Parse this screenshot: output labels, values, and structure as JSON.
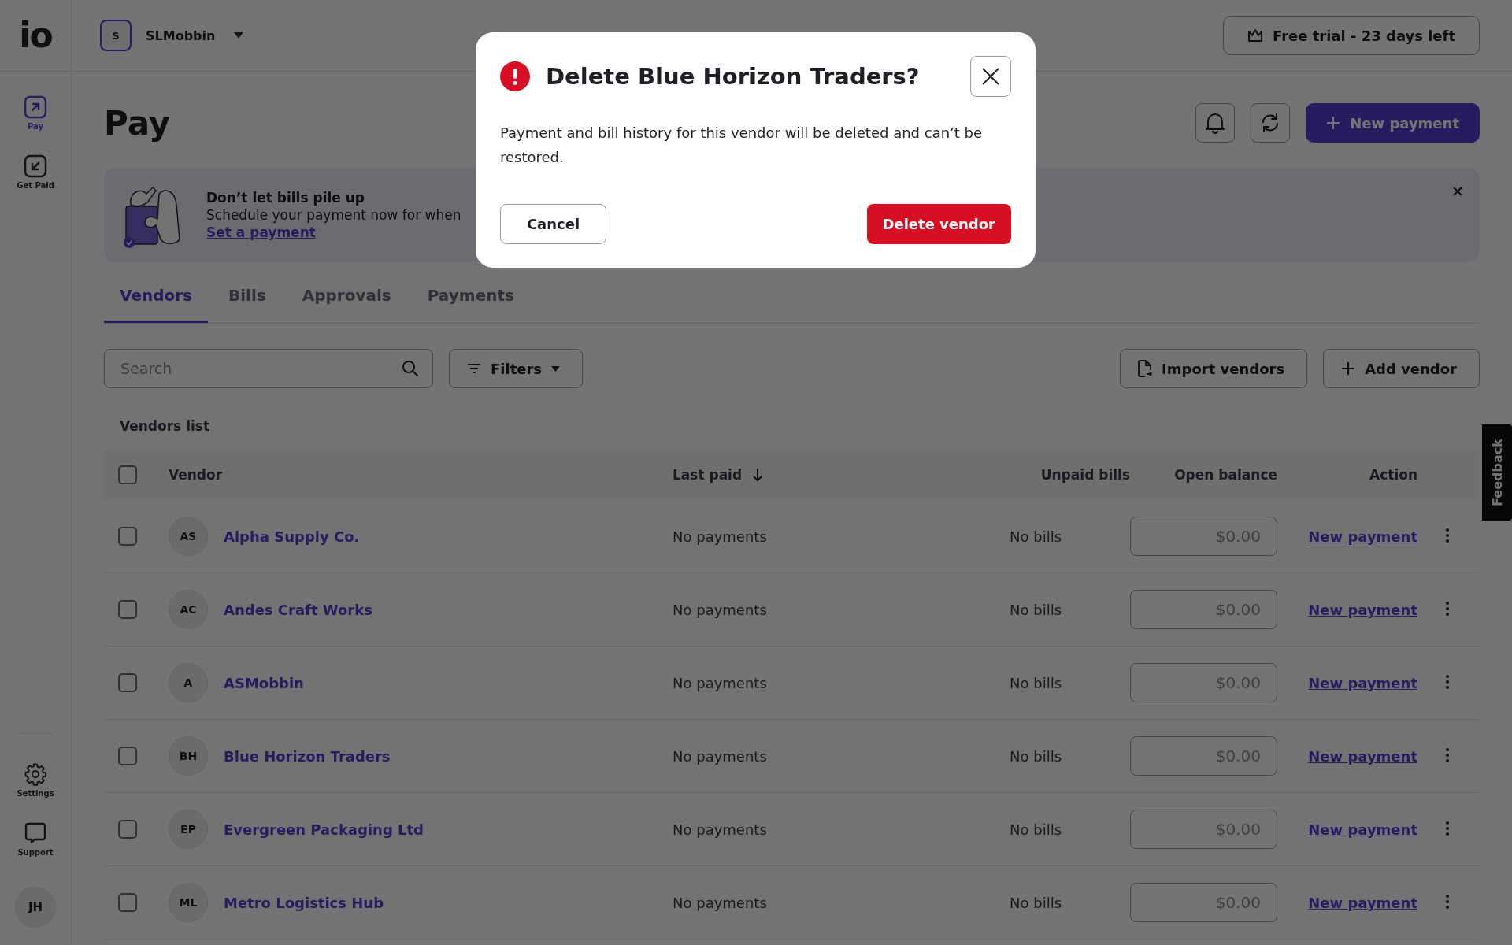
{
  "logo": "io",
  "sidebar": {
    "items": [
      {
        "label": "Pay",
        "kind": "pay",
        "selected": true
      },
      {
        "label": "Get Paid",
        "kind": "get-paid",
        "selected": false
      }
    ],
    "bottom_items": [
      {
        "label": "Settings",
        "kind": "settings"
      },
      {
        "label": "Support",
        "kind": "support"
      }
    ],
    "user_initials": "JH"
  },
  "header": {
    "workspace_initial": "S",
    "workspace_name": "SLMobbin",
    "trial_badge": "Free trial - 23 days left"
  },
  "page": {
    "title": "Pay",
    "new_payment_button": "New payment"
  },
  "banner": {
    "title": "Don’t let bills pile up",
    "text": "Schedule your payment now for when",
    "link": "Set a payment"
  },
  "tabs": [
    {
      "label": "Vendors",
      "selected": true
    },
    {
      "label": "Bills",
      "selected": false
    },
    {
      "label": "Approvals",
      "selected": false
    },
    {
      "label": "Payments",
      "selected": false
    }
  ],
  "search": {
    "placeholder": "Search"
  },
  "filters_button": "Filters",
  "import_button": "Import vendors",
  "add_button": "Add vendor",
  "list_title": "Vendors list",
  "table": {
    "select_all_checked": false,
    "columns": [
      {
        "label": "Vendor",
        "sorted": false
      },
      {
        "label": "Last paid",
        "sorted": true
      },
      {
        "label": "Unpaid bills",
        "sorted": false
      },
      {
        "label": "Open balance",
        "sorted": false
      },
      {
        "label": "Action",
        "sorted": false
      }
    ],
    "rows": [
      {
        "checked": false,
        "initials": "AS",
        "name": "Alpha Supply Co.",
        "last_paid": "No payments",
        "unpaid_bills": "No bills",
        "open_balance": "$0.00",
        "action": "New payment"
      },
      {
        "checked": false,
        "initials": "AC",
        "name": "Andes Craft Works",
        "last_paid": "No payments",
        "unpaid_bills": "No bills",
        "open_balance": "$0.00",
        "action": "New payment"
      },
      {
        "checked": false,
        "initials": "A",
        "name": "ASMobbin",
        "last_paid": "No payments",
        "unpaid_bills": "No bills",
        "open_balance": "$0.00",
        "action": "New payment"
      },
      {
        "checked": false,
        "initials": "BH",
        "name": "Blue Horizon Traders",
        "last_paid": "No payments",
        "unpaid_bills": "No bills",
        "open_balance": "$0.00",
        "action": "New payment"
      },
      {
        "checked": false,
        "initials": "EP",
        "name": "Evergreen Packaging Ltd",
        "last_paid": "No payments",
        "unpaid_bills": "No bills",
        "open_balance": "$0.00",
        "action": "New payment"
      },
      {
        "checked": false,
        "initials": "ML",
        "name": "Metro Logistics Hub",
        "last_paid": "No payments",
        "unpaid_bills": "No bills",
        "open_balance": "$0.00",
        "action": "New payment"
      }
    ]
  },
  "feedback": "Feedback",
  "dialog": {
    "title": "Delete Blue Horizon Traders?",
    "message": "Payment and bill history for this vendor will be deleted and can’t be restored.",
    "cancel": "Cancel",
    "confirm": "Delete vendor"
  }
}
